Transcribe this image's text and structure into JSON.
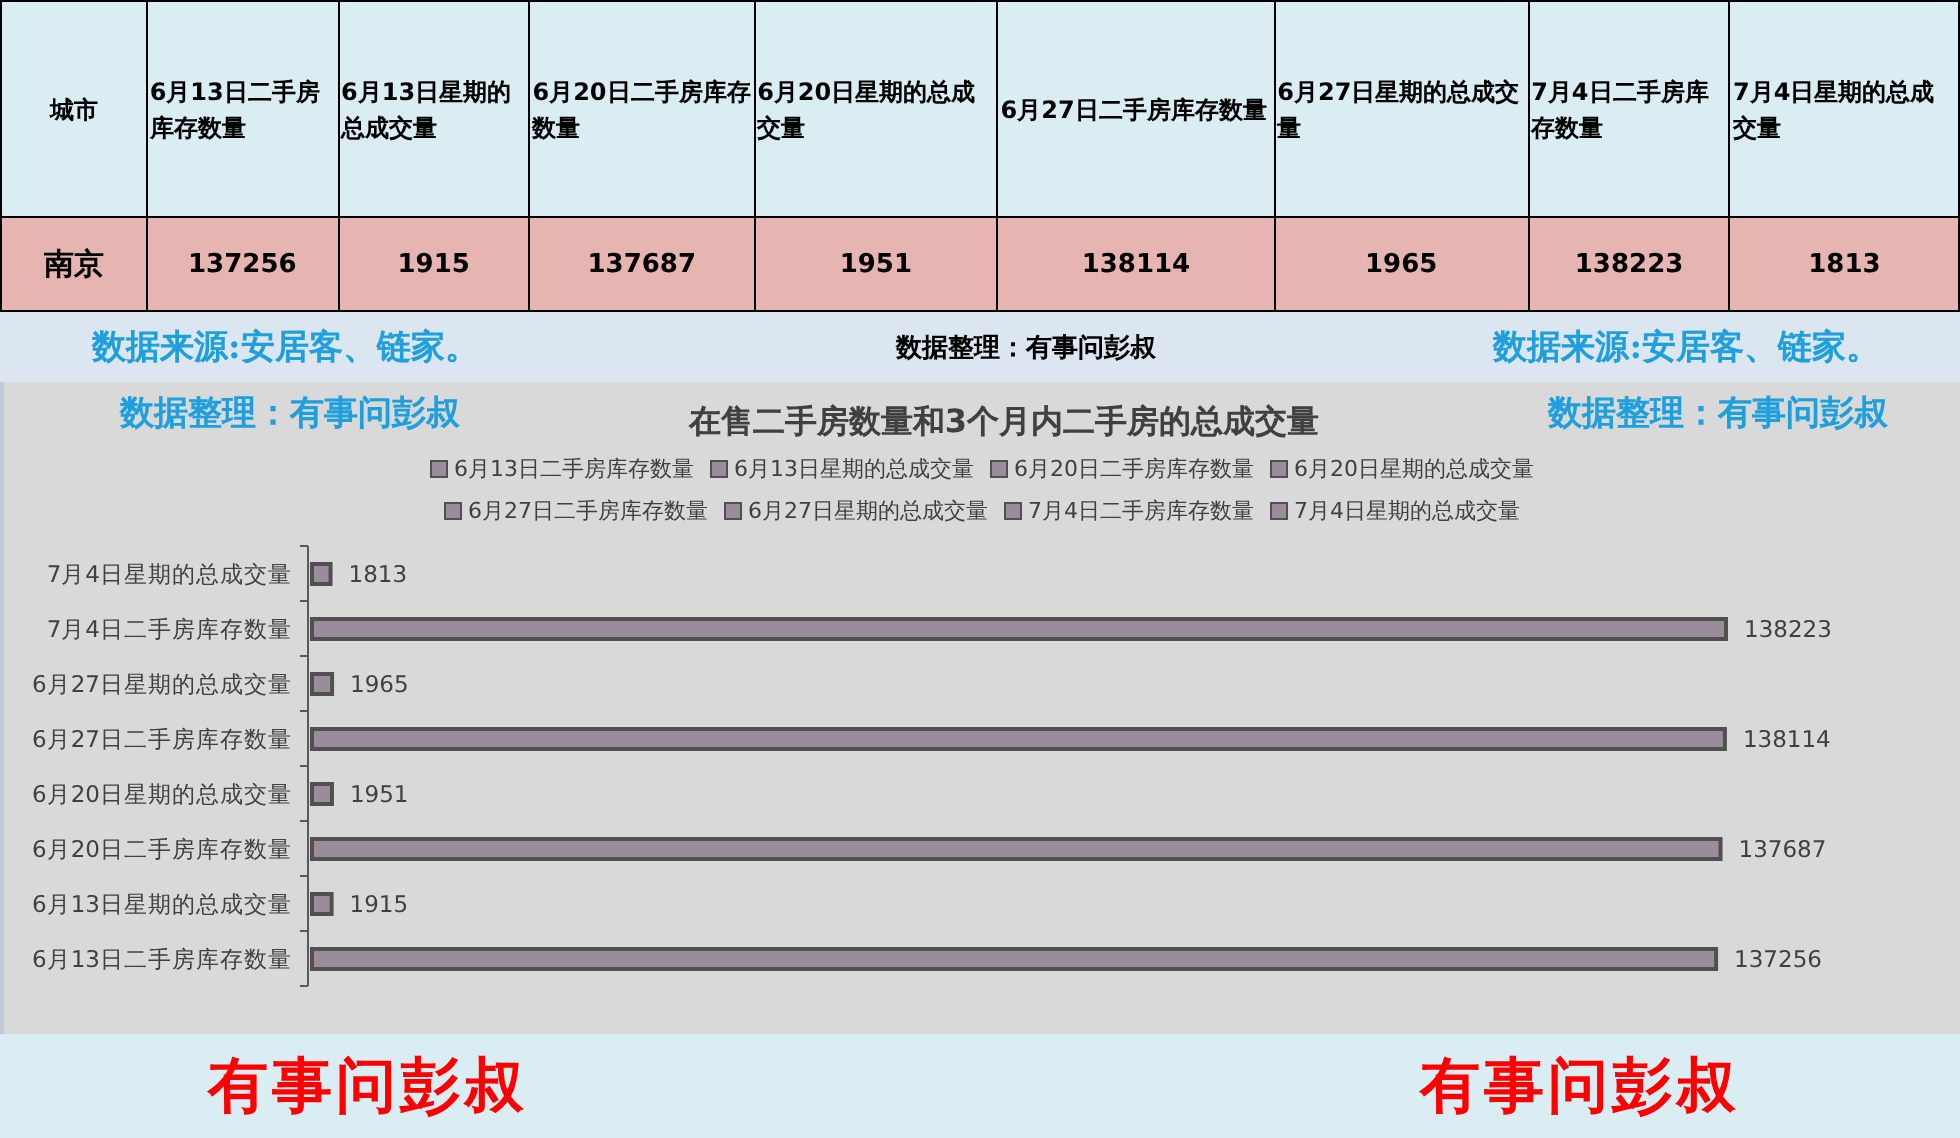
{
  "table": {
    "columns": [
      "城市",
      "6月13日二手房库存数量",
      "6月13日星期的总成交量",
      "6月20日二手房库存数量",
      "6月20日星期的总成交量",
      "6月27日二手房库存数量",
      "6月27日星期的总成交量",
      "7月4日二手房库存数量",
      "7月4日星期的总成交量"
    ],
    "rows": [
      [
        "南京",
        "137256",
        "1915",
        "137687",
        "1951",
        "138114",
        "1965",
        "138223",
        "1813"
      ]
    ]
  },
  "notes": {
    "source_left": "数据来源:安居客、链家。",
    "center": "数据整理：有事问彭叔",
    "source_right": "数据来源:安居客、链家。",
    "credit_left": "数据整理：有事问彭叔",
    "credit_right": "数据整理：有事问彭叔"
  },
  "chart": {
    "legend": [
      "6月13日二手房库存数量",
      "6月13日星期的总成交量",
      "6月20日二手房库存数量",
      "6月20日星期的总成交量",
      "6月27日二手房库存数量",
      "6月27日星期的总成交量",
      "7月4日二手房库存数量",
      "7月4日星期的总成交量"
    ],
    "chart_data": {
      "type": "bar",
      "orientation": "horizontal",
      "title": "在售二手房数量和3个月内二手房的总成交量",
      "categories": [
        "7月4日星期的总成交量",
        "7月4日二手房库存数量",
        "6月27日星期的总成交量",
        "6月27日二手房库存数量",
        "6月20日星期的总成交量",
        "6月20日二手房库存数量",
        "6月13日星期的总成交量",
        "6月13日二手房库存数量"
      ],
      "values": [
        1813,
        138223,
        1965,
        138114,
        1951,
        137687,
        1915,
        137256
      ],
      "data_labels": true
    }
  },
  "footer": {
    "left": "有事问彭叔",
    "right": "有事问彭叔"
  }
}
